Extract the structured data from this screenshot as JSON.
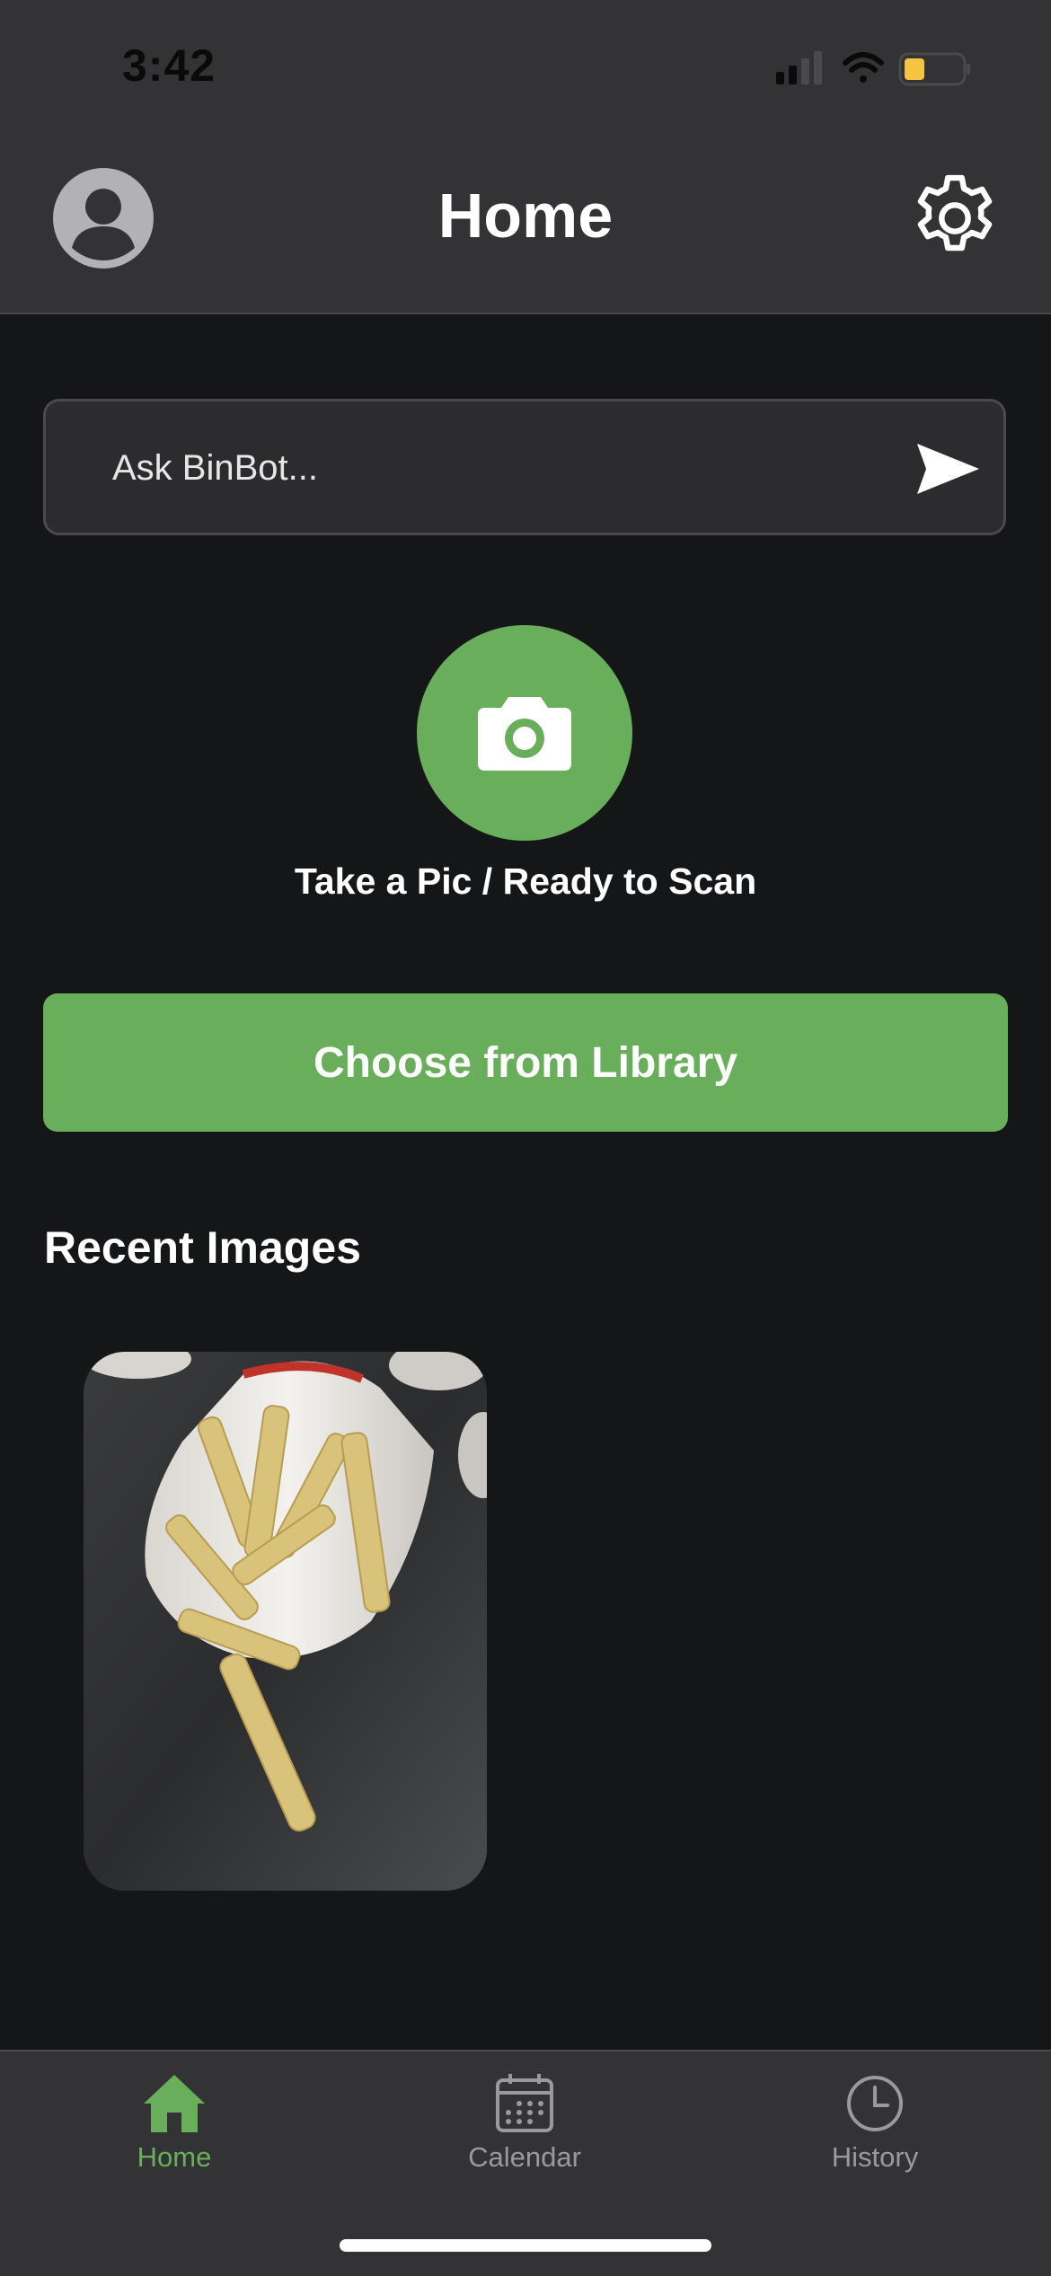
{
  "status_bar": {
    "time": "3:42"
  },
  "header": {
    "title": "Home"
  },
  "ask": {
    "placeholder": "Ask BinBot..."
  },
  "scan": {
    "label": "Take a Pic / Ready to Scan"
  },
  "library": {
    "label": "Choose from Library"
  },
  "recent": {
    "heading": "Recent Images"
  },
  "tabs": [
    {
      "label": "Home",
      "icon": "home-icon",
      "active": true
    },
    {
      "label": "Calendar",
      "icon": "calendar-icon",
      "active": false
    },
    {
      "label": "History",
      "icon": "clock-icon",
      "active": false
    }
  ],
  "colors": {
    "accent": "#69ae5b",
    "background": "#151618",
    "bar": "#333335",
    "inactive_tab": "#9a9a9c"
  }
}
